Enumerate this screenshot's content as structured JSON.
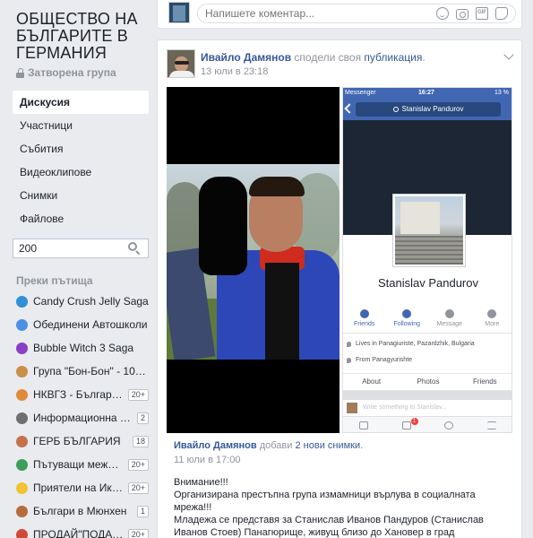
{
  "group": {
    "title": "ОБЩЕСТВО НА БЪЛГАРИТЕ В ГЕРМАНИЯ",
    "privacy": "Затворена група"
  },
  "nav": [
    {
      "label": "Дискусия",
      "active": true
    },
    {
      "label": "Участници",
      "active": false
    },
    {
      "label": "Събития",
      "active": false
    },
    {
      "label": "Видеоклипове",
      "active": false
    },
    {
      "label": "Снимки",
      "active": false
    },
    {
      "label": "Файлове",
      "active": false
    }
  ],
  "search": {
    "value": "200"
  },
  "shortcuts": {
    "title": "Преки пътища",
    "items": [
      {
        "label": "Candy Crush Jelly Saga",
        "badge": "",
        "icon": "game-icon",
        "color": "#2f8fd8"
      },
      {
        "label": "Обединени Автошколи",
        "badge": "",
        "icon": "group-icon",
        "color": "#4a90e2"
      },
      {
        "label": "Bubble Witch 3 Saga",
        "badge": "",
        "icon": "game-icon",
        "color": "#8a3fc4"
      },
      {
        "label": "Група \"Бон-Бон\" - 104 ...",
        "badge": "",
        "icon": "group-icon",
        "color": "#c98f4a"
      },
      {
        "label": "НКВГЗ - България...",
        "badge": "20+",
        "icon": "group-icon",
        "color": "#e08a3c"
      },
      {
        "label": "Информационна Аге...",
        "badge": "2",
        "icon": "group-icon",
        "color": "#6f6f6f"
      },
      {
        "label": "ГЕРБ БЪЛГАРИЯ",
        "badge": "18",
        "icon": "group-icon",
        "color": "#c7704e"
      },
      {
        "label": "Пътуващи между ...",
        "badge": "20+",
        "icon": "globe-icon",
        "color": "#3b9e5a"
      },
      {
        "label": "Приятели на Икар ...",
        "badge": "20+",
        "icon": "bulb-icon",
        "color": "#f2c230"
      },
      {
        "label": "Българи в Мюнхен",
        "badge": "1",
        "icon": "group-icon",
        "color": "#b56b3e"
      },
      {
        "label": "ПРОДАЙ\"ПОДАР...",
        "badge": "20+",
        "icon": "group-icon",
        "color": "#d14836"
      }
    ]
  },
  "composer": {
    "placeholder": "Напишете коментар..."
  },
  "post": {
    "author": "Ивайло Дамянов",
    "action": " сподели своя ",
    "link": "публикация",
    "suffix": ".",
    "time": "13 юли в 23:18"
  },
  "phone": {
    "carrier": "Messenger",
    "clock": "16:27",
    "battery": "13 %",
    "search": "Stanislav Pandurov",
    "name": "Stanislav Pandurov",
    "actions": [
      "Friends",
      "Following",
      "Message",
      "More"
    ],
    "info": [
      "Lives in Panagiuriste, Pazardzhik, Bulgaria",
      "From Panagyurishte"
    ],
    "tabs": [
      "About",
      "Photos",
      "Friends"
    ],
    "write": "Write something to Stanislav...",
    "notification_badge": "1"
  },
  "shared": {
    "author": "Ивайло Дамянов",
    "action": " добави ",
    "link": "2 нови снимки",
    "suffix": ".",
    "time": "11 юли в 17:00",
    "lines": [
      "Внимание!!!",
      "Организирана престъпна група измамници върлува в социалната мрежа!!!",
      "Младежа се представя за Станислав Иванов Пандуров (Станислав Иванов Стоев) Панагюрище, живущ близо до Хановер в град Braunschweig, работи заедно с Димитър Борисов!"
    ]
  }
}
